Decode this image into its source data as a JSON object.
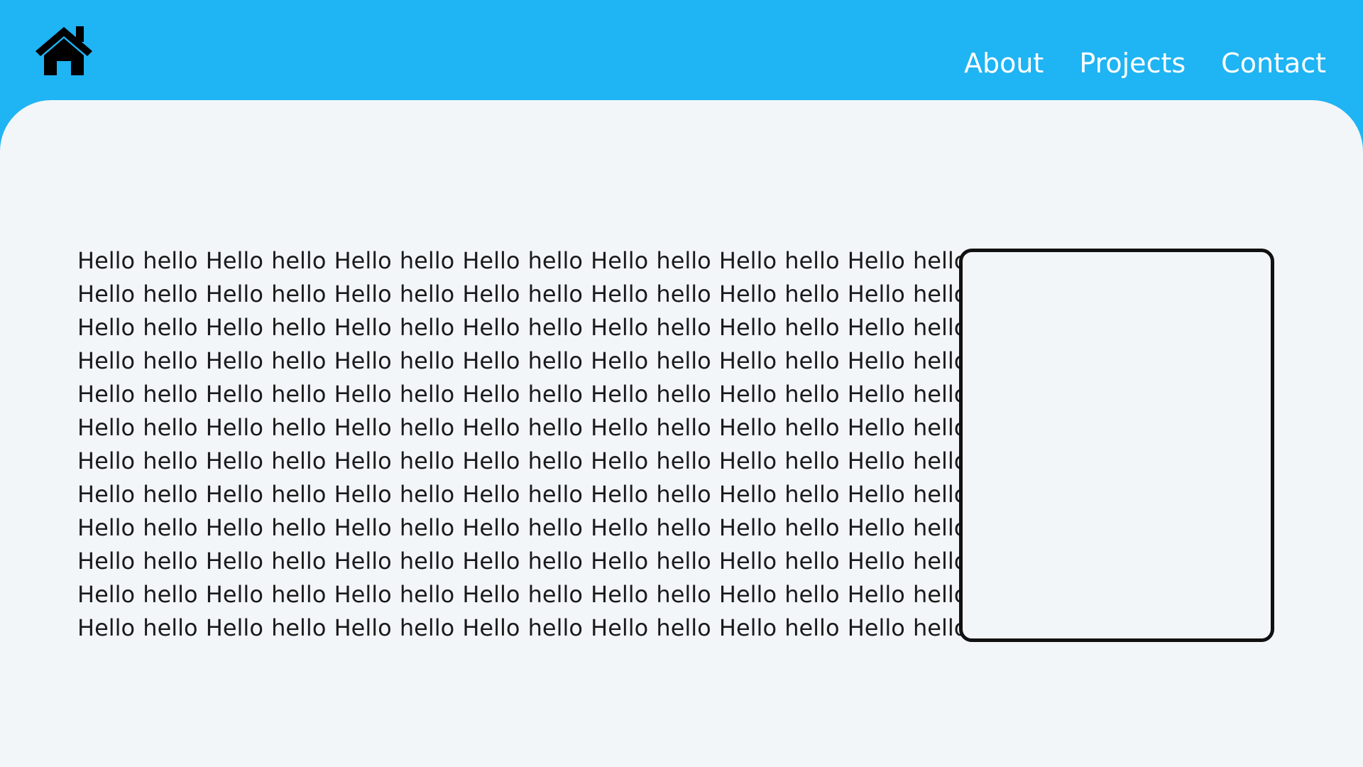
{
  "header": {
    "background_color": "#1fb4f3",
    "home_icon": "home-icon",
    "nav": [
      {
        "label": "About"
      },
      {
        "label": "Projects"
      },
      {
        "label": "Contact"
      }
    ]
  },
  "main": {
    "background_color": "#f2f6f9",
    "text_lines": [
      "Hello hello Hello hello Hello hello Hello hello Hello hello Hello hello Hello hello",
      "Hello hello Hello hello Hello hello Hello hello Hello hello Hello hello Hello hello",
      "Hello hello Hello hello Hello hello Hello hello Hello hello Hello hello Hello hello",
      "Hello hello Hello hello Hello hello Hello hello Hello hello Hello hello Hello hello",
      "Hello hello Hello hello Hello hello Hello hello Hello hello Hello hello Hello hello",
      "Hello hello Hello hello Hello hello Hello hello Hello hello Hello hello Hello hello",
      "Hello hello Hello hello Hello hello Hello hello Hello hello Hello hello Hello hello",
      "Hello hello Hello hello Hello hello Hello hello Hello hello Hello hello Hello hello",
      "Hello hello Hello hello Hello hello Hello hello Hello hello Hello hello Hello hello",
      "Hello hello Hello hello Hello hello Hello hello Hello hello Hello hello Hello hello",
      "Hello hello Hello hello Hello hello Hello hello Hello hello Hello hello Hello hello",
      "Hello hello Hello hello Hello hello Hello hello Hello hello Hello hello Hello hello"
    ]
  }
}
